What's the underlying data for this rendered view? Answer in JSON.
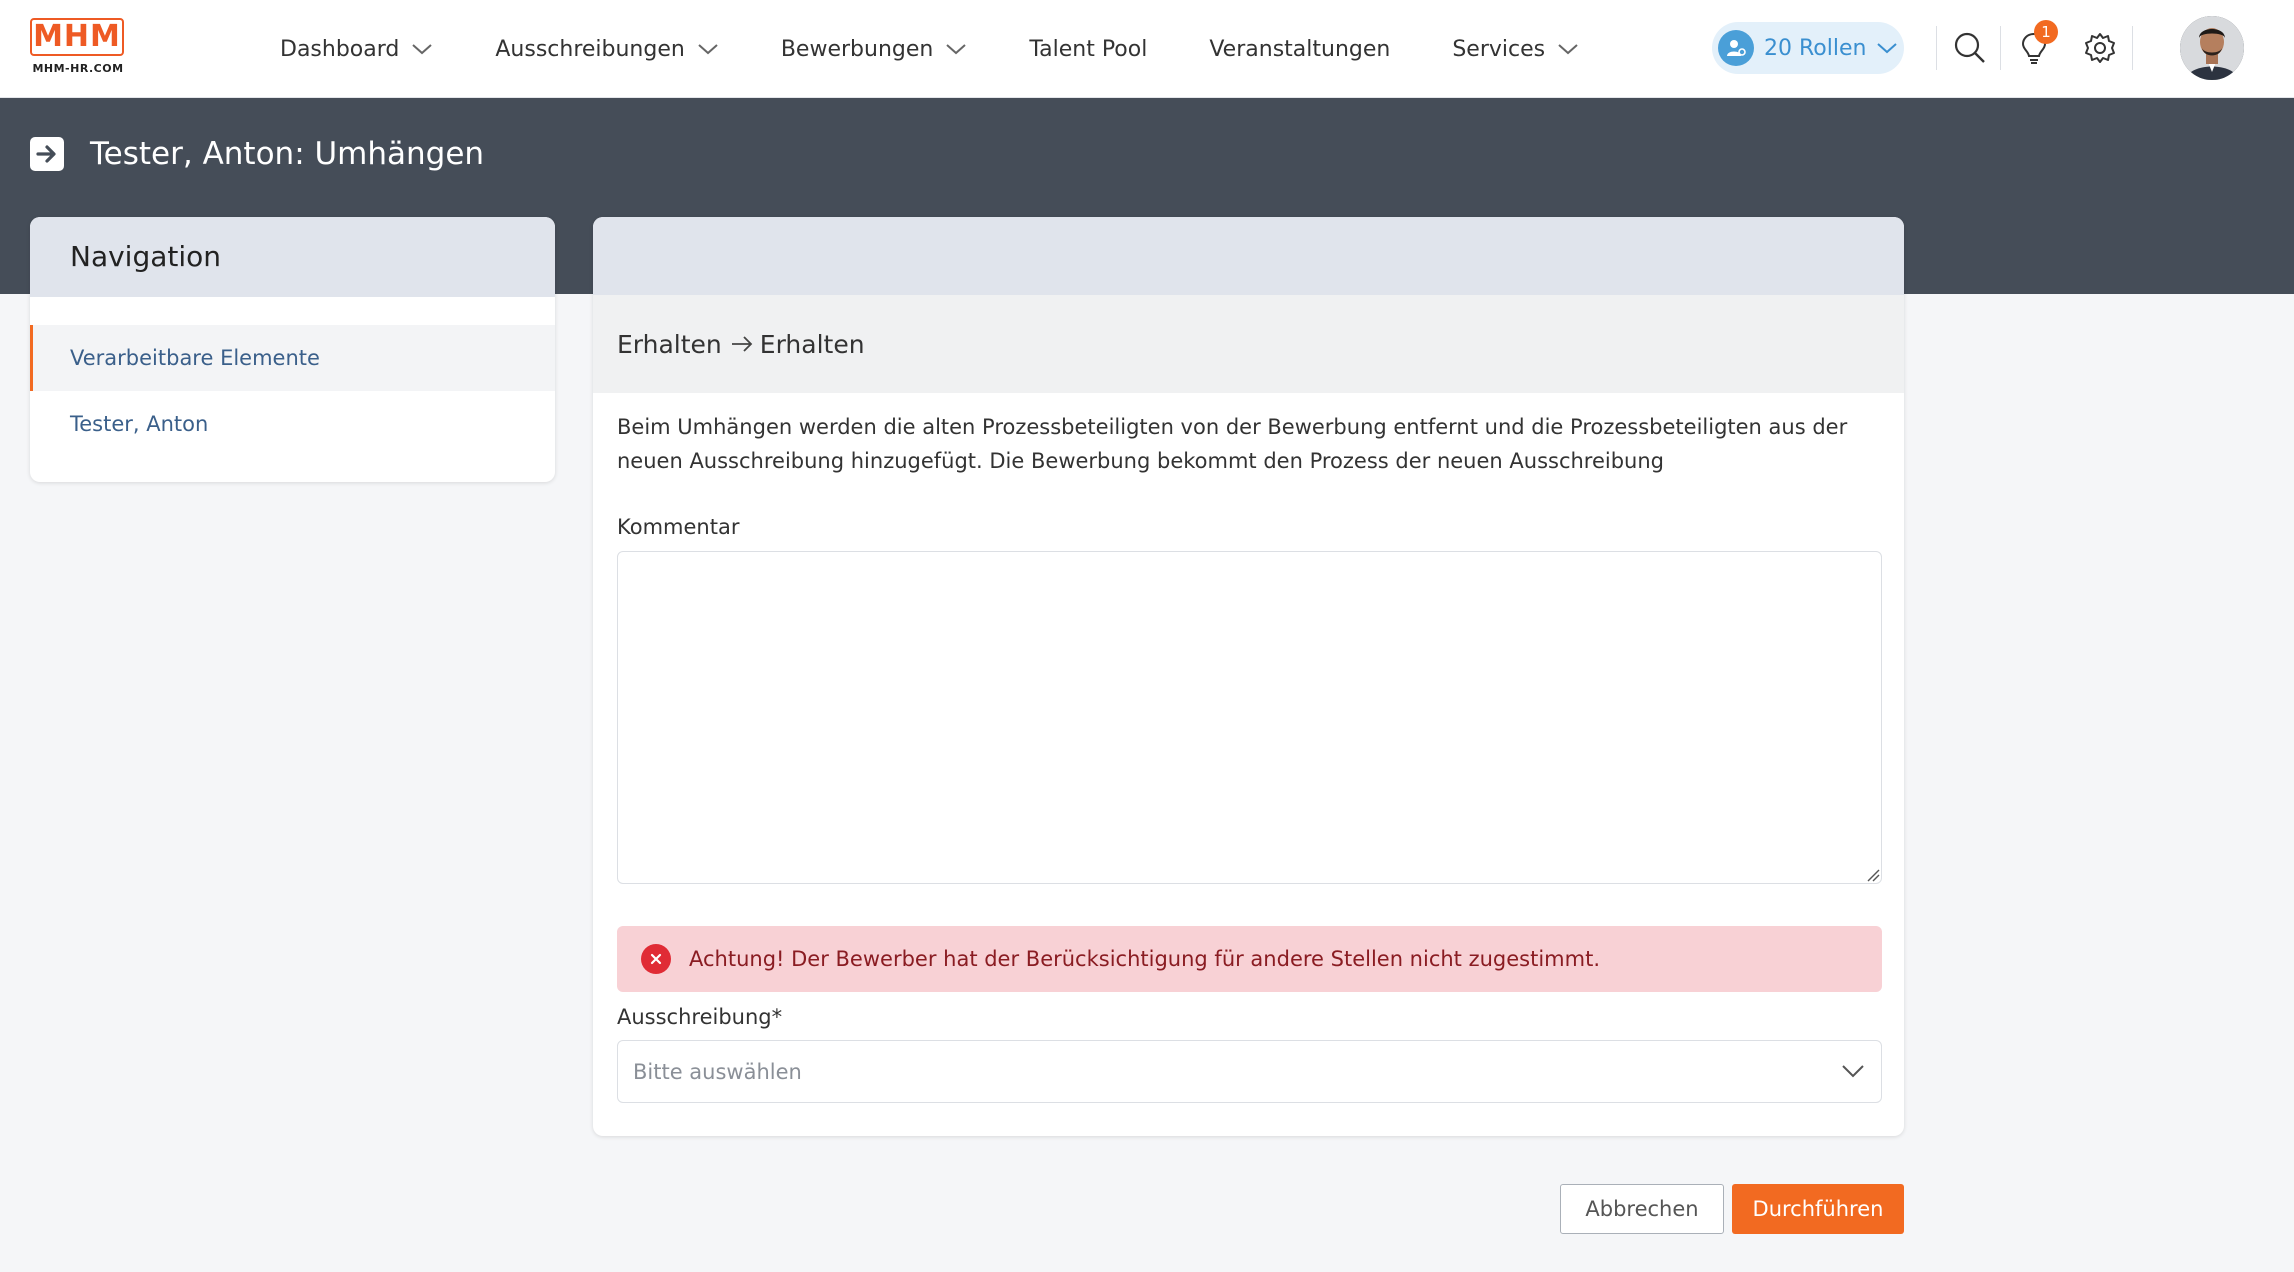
{
  "app": {
    "logo_text": "MHM",
    "logo_sub": "MHM-HR.COM"
  },
  "nav": [
    {
      "label": "Dashboard",
      "has_dropdown": true
    },
    {
      "label": "Ausschreibungen",
      "has_dropdown": true
    },
    {
      "label": "Bewerbungen",
      "has_dropdown": true
    },
    {
      "label": "Talent Pool",
      "has_dropdown": false
    },
    {
      "label": "Veranstaltungen",
      "has_dropdown": false
    },
    {
      "label": "Services",
      "has_dropdown": true
    }
  ],
  "header": {
    "roles_label": "20 Rollen",
    "notification_count": "1",
    "icons": [
      "search-icon",
      "lightbulb-icon",
      "gear-icon"
    ]
  },
  "page": {
    "title": "Tester, Anton: Umhängen"
  },
  "side_nav": {
    "title": "Navigation",
    "items": [
      {
        "label": "Verarbeitbare Elemente",
        "active": true
      },
      {
        "label": "Tester, Anton",
        "active": false
      }
    ]
  },
  "main": {
    "section_from": "Erhalten",
    "section_to": "Erhalten",
    "info": "Beim Umhängen werden die alten Prozessbeteiligten von der Bewerbung entfernt und die Prozessbeteiligten aus der neuen Ausschreibung hinzugefügt. Die Bewerbung bekommt den Prozess der neuen Ausschreibung",
    "comment_label": "Kommentar",
    "comment_value": "",
    "alert_text": "Achtung! Der Bewerber hat der Berücksichtigung für andere Stellen nicht zugestimmt.",
    "select_label": "Ausschreibung*",
    "select_placeholder": "Bitte auswählen"
  },
  "footer": {
    "cancel_label": "Abbrechen",
    "submit_label": "Durchführen"
  },
  "colors": {
    "accent": "#f26a21",
    "header_band": "#454d58",
    "link": "#3a5f8a",
    "alert_bg": "#f8d1d5"
  }
}
